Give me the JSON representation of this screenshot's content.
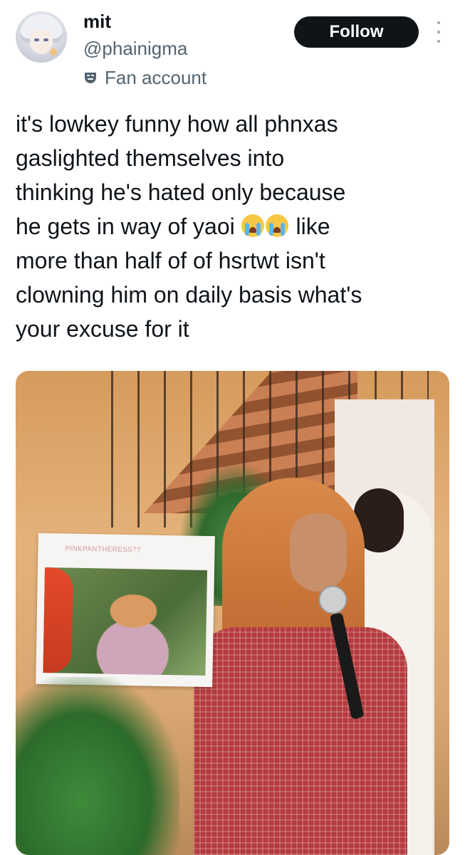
{
  "author": {
    "display_name": "mit",
    "handle": "@phainigma",
    "badge_label": "Fan account"
  },
  "actions": {
    "follow_label": "Follow"
  },
  "tweet": {
    "line1": "it's lowkey funny how all phnxas",
    "line2": "gaslighted themselves into",
    "line3": "thinking he's hated only because",
    "line4_before": "he gets in way of yaoi",
    "line4_after": "like",
    "line5": "more than half of of hsrtwt isn't",
    "line6": "clowning him on daily basis what's",
    "line7": "your excuse for it",
    "emoji": [
      "loudly-crying-face",
      "loudly-crying-face"
    ]
  },
  "media": {
    "sign_text": "PINKPANTHERESS??"
  },
  "colors": {
    "follow_bg": "#0f1419",
    "secondary_text": "#536471"
  }
}
